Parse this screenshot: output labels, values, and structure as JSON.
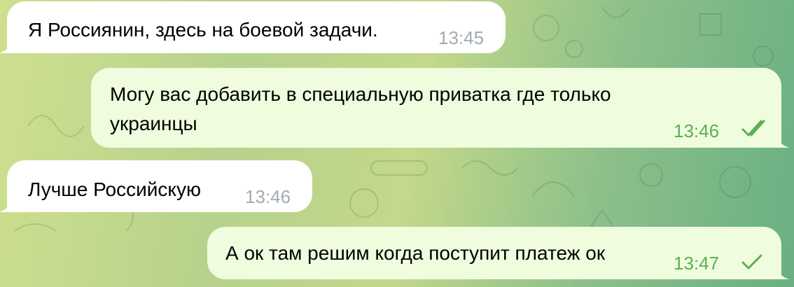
{
  "chat": {
    "messages": [
      {
        "direction": "incoming",
        "text": "Я Россиянин, здесь на боевой задачи.",
        "time": "13:45"
      },
      {
        "direction": "outgoing",
        "text": "Могу вас добавить в специальную приватка где только украинцы",
        "time": "13:46",
        "status_icon": "double-check-icon"
      },
      {
        "direction": "incoming",
        "text": "Лучше Российскую",
        "time": "13:46"
      },
      {
        "direction": "outgoing",
        "text": "А ок там решим когда поступит платеж ок",
        "time": "13:47",
        "status_icon": "single-check-icon"
      }
    ]
  },
  "colors": {
    "incoming_bubble": "#ffffff",
    "outgoing_bubble": "#effdde",
    "incoming_time": "#a3abb2",
    "outgoing_time": "#5dae52",
    "wallpaper_left": "#cfe08f",
    "wallpaper_right": "#6aaf84"
  }
}
